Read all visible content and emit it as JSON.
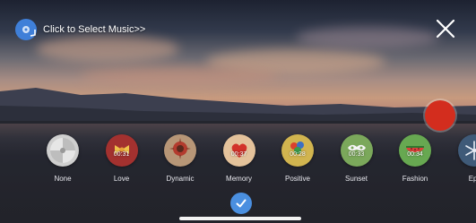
{
  "header": {
    "music_label": "Click to Select Music>>",
    "music_icon": "music-disc-icon",
    "close_icon": "close-icon"
  },
  "record": {
    "icon": "record-icon",
    "color": "#d32d1e"
  },
  "filters": [
    {
      "name": "None",
      "duration": "",
      "color": "#cfcfcf",
      "icon": "disc-icon"
    },
    {
      "name": "Love",
      "duration": "00:31",
      "color": "#a3312f",
      "icon": "bow-icon"
    },
    {
      "name": "Dynamic",
      "duration": "",
      "color": "#b79677",
      "icon": "sunburst-icon"
    },
    {
      "name": "Memory",
      "duration": "00:37",
      "color": "#e4c29b",
      "icon": "heart-icon"
    },
    {
      "name": "Positive",
      "duration": "00:28",
      "color": "#d1b44f",
      "icon": "balloons-icon"
    },
    {
      "name": "Sunset",
      "duration": "00:33",
      "color": "#7ba85b",
      "icon": "mask-icon"
    },
    {
      "name": "Fashion",
      "duration": "00:34",
      "color": "#67a851",
      "icon": "watermelon-icon"
    },
    {
      "name": "Epi",
      "duration": "",
      "color": "#3f5a78",
      "icon": "snowflake-icon"
    }
  ],
  "confirm": {
    "icon": "checkmark-icon",
    "color": "#4a8fe0"
  }
}
